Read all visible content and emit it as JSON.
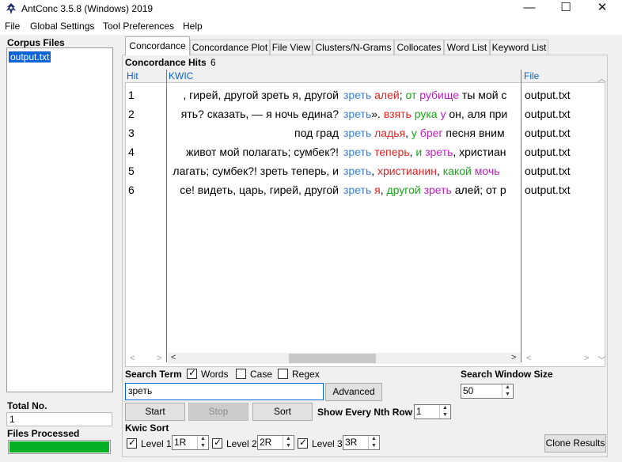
{
  "window": {
    "title": "AntConc 3.5.8 (Windows) 2019",
    "controls": {
      "minimize": "—",
      "maximize": "☐",
      "close": "✕"
    }
  },
  "menu": [
    "File",
    "Global Settings",
    "Tool Preferences",
    "Help"
  ],
  "sidebar": {
    "corpus_files_label": "Corpus Files",
    "files": [
      "output.txt"
    ],
    "total_label": "Total No.",
    "total_value": "1",
    "processed_label": "Files Processed",
    "progress_fraction": 1.0,
    "progress_color": "#06b025"
  },
  "tabs": [
    "Concordance",
    "Concordance Plot",
    "File View",
    "Clusters/N-Grams",
    "Collocates",
    "Word List",
    "Keyword List"
  ],
  "active_tab": "Concordance",
  "concordance": {
    "hits_label": "Concordance Hits",
    "hits_count": "6",
    "columns": {
      "hit": "Hit",
      "kwic": "KWIC",
      "file": "File"
    },
    "rows": [
      {
        "hit": "1",
        "left": ", гирей, другой зреть я, другой",
        "right": [
          [
            "зреть",
            "blue"
          ],
          [
            " ",
            ""
          ],
          [
            "алей",
            "red"
          ],
          [
            "; ",
            ""
          ],
          [
            "от",
            "green"
          ],
          [
            " ",
            ""
          ],
          [
            "рубище",
            "magenta"
          ],
          [
            " ты мой с",
            ""
          ]
        ],
        "file": "output.txt"
      },
      {
        "hit": "2",
        "left": "ять? сказать, — я ночь едина?",
        "right": [
          [
            "зреть",
            "blue"
          ],
          [
            "». ",
            ""
          ],
          [
            "взять",
            "red"
          ],
          [
            " ",
            ""
          ],
          [
            "рука",
            "green"
          ],
          [
            " ",
            ""
          ],
          [
            "у",
            "magenta"
          ],
          [
            " он, аля при",
            ""
          ]
        ],
        "file": "output.txt"
      },
      {
        "hit": "3",
        "left": "под град",
        "right": [
          [
            "зреть",
            "blue"
          ],
          [
            " ",
            ""
          ],
          [
            "ладья",
            "red"
          ],
          [
            ", ",
            ""
          ],
          [
            "у",
            "green"
          ],
          [
            " ",
            ""
          ],
          [
            "брег",
            "magenta"
          ],
          [
            " песня вним",
            ""
          ]
        ],
        "file": "output.txt"
      },
      {
        "hit": "4",
        "left": "живот мой полагать; сумбек?!",
        "right": [
          [
            "зреть",
            "blue"
          ],
          [
            " ",
            ""
          ],
          [
            "теперь",
            "red"
          ],
          [
            ", ",
            ""
          ],
          [
            "и",
            "green"
          ],
          [
            " ",
            ""
          ],
          [
            "зреть",
            "magenta"
          ],
          [
            ", христиан",
            ""
          ]
        ],
        "file": "output.txt"
      },
      {
        "hit": "5",
        "left": "лагать; сумбек?! зреть теперь, и",
        "right": [
          [
            "зреть",
            "blue"
          ],
          [
            ", ",
            ""
          ],
          [
            "христианин",
            "red"
          ],
          [
            ", ",
            ""
          ],
          [
            "какой",
            "green"
          ],
          [
            " ",
            ""
          ],
          [
            "мочь",
            "magenta"
          ],
          [
            " ",
            ""
          ]
        ],
        "file": "output.txt"
      },
      {
        "hit": "6",
        "left": "се! видеть, царь, гирей, другой",
        "right": [
          [
            "зреть",
            "blue"
          ],
          [
            " ",
            ""
          ],
          [
            "я",
            "red"
          ],
          [
            ", ",
            ""
          ],
          [
            "другой",
            "green"
          ],
          [
            " ",
            ""
          ],
          [
            "зреть",
            "magenta"
          ],
          [
            " алей; от р",
            ""
          ]
        ],
        "file": "output.txt"
      }
    ]
  },
  "search": {
    "term_label": "Search Term",
    "words_label": "Words",
    "words_checked": true,
    "case_label": "Case",
    "case_checked": false,
    "regex_label": "Regex",
    "regex_checked": false,
    "term_value": "зреть",
    "advanced_label": "Advanced",
    "window_size_label": "Search Window Size",
    "window_size_value": "50"
  },
  "actions": {
    "start_label": "Start",
    "stop_label": "Stop",
    "sort_label": "Sort",
    "nth_row_label": "Show Every Nth Row",
    "nth_row_value": "1"
  },
  "kwic_sort": {
    "label": "Kwic Sort",
    "levels": [
      {
        "label": "Level 1",
        "value": "1R",
        "checked": true
      },
      {
        "label": "Level 2",
        "value": "2R",
        "checked": true
      },
      {
        "label": "Level 3",
        "value": "3R",
        "checked": true
      }
    ],
    "clone_label": "Clone Results"
  },
  "colors": {
    "col_header": "#0b62c9",
    "node": "#3a7fd8",
    "r1": "#e02424",
    "r2": "#19a619",
    "r3": "#c020c0",
    "selection": "#0a64d7"
  }
}
